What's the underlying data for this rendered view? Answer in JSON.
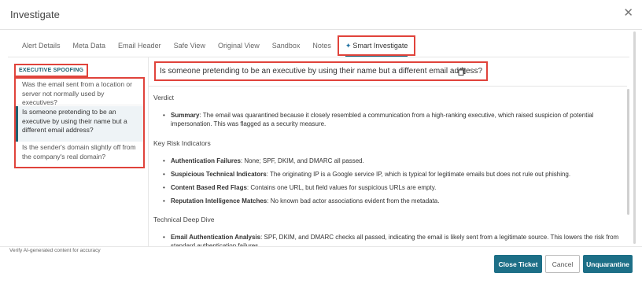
{
  "window": {
    "title": "Investigate",
    "close_glyph": "✕"
  },
  "tabs": [
    {
      "label": "Alert Details"
    },
    {
      "label": "Meta Data"
    },
    {
      "label": "Email Header"
    },
    {
      "label": "Safe View"
    },
    {
      "label": "Original View"
    },
    {
      "label": "Sandbox"
    },
    {
      "label": "Notes"
    },
    {
      "label": "Smart Investigate",
      "icon": "sparkle-icon",
      "active": true
    }
  ],
  "sidebar": {
    "category": "EXECUTIVE SPOOFING",
    "questions": [
      {
        "text": "Was the email sent from a location or server not normally used by executives?"
      },
      {
        "text": "Is someone pretending to be an executive by using their name but a different email address?",
        "selected": true
      },
      {
        "text": "Is the sender's domain slightly off from the company's real domain?"
      }
    ]
  },
  "main": {
    "question": "Is someone pretending to be an executive by using their name but a different email address?",
    "copy_icon": "copy-icon",
    "sections": {
      "verdict": {
        "heading": "Verdict",
        "items": [
          {
            "label": "Summary",
            "text": ": The email was quarantined because it closely resembled a communication from a high-ranking executive, which raised suspicion of potential impersonation. This was flagged as a security measure."
          }
        ]
      },
      "risk": {
        "heading": "Key Risk Indicators",
        "items": [
          {
            "label": "Authentication Failures",
            "text": ": None; SPF, DKIM, and DMARC all passed."
          },
          {
            "label": "Suspicious Technical Indicators",
            "text": ": The originating IP is a Google service IP, which is typical for legitimate emails but does not rule out phishing."
          },
          {
            "label": "Content Based Red Flags",
            "text": ": Contains one URL, but field values for suspicious URLs are empty."
          },
          {
            "label": "Reputation Intelligence Matches",
            "text": ": No known bad actor associations evident from the metadata."
          }
        ]
      },
      "deep": {
        "heading": "Technical Deep Dive",
        "items": [
          {
            "label": "Email Authentication Analysis",
            "text": ": SPF, DKIM, and DMARC checks all passed, indicating the email is likely sent from a legitimate source. This lowers the risk from standard authentication failures."
          }
        ]
      }
    }
  },
  "footer": {
    "note": "Verify AI-generated content for accuracy",
    "close_ticket": "Close Ticket",
    "cancel": "Cancel",
    "unquarantine": "Unquarantine"
  },
  "colors": {
    "accent": "#1d6f87",
    "highlight_border": "#e0433b",
    "selected_bg": "#eef3f6"
  }
}
